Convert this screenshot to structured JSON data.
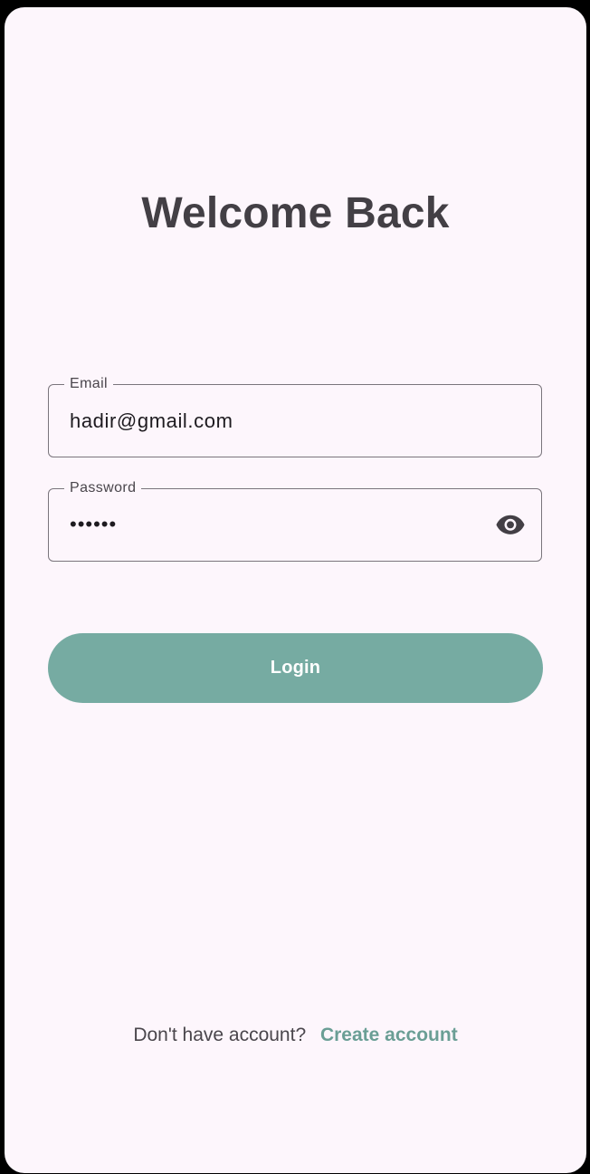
{
  "header": {
    "title": "Welcome Back"
  },
  "form": {
    "email": {
      "label": "Email",
      "value": "hadir@gmail.com"
    },
    "password": {
      "label": "Password",
      "value": "••••••",
      "visibility_icon": "eye-icon"
    },
    "login_label": "Login"
  },
  "footer": {
    "prompt": "Don't have account?",
    "link_label": "Create account"
  },
  "colors": {
    "background": "#fdf6fc",
    "accent": "#76aba2",
    "link": "#6a9e95",
    "title": "#433f45"
  }
}
